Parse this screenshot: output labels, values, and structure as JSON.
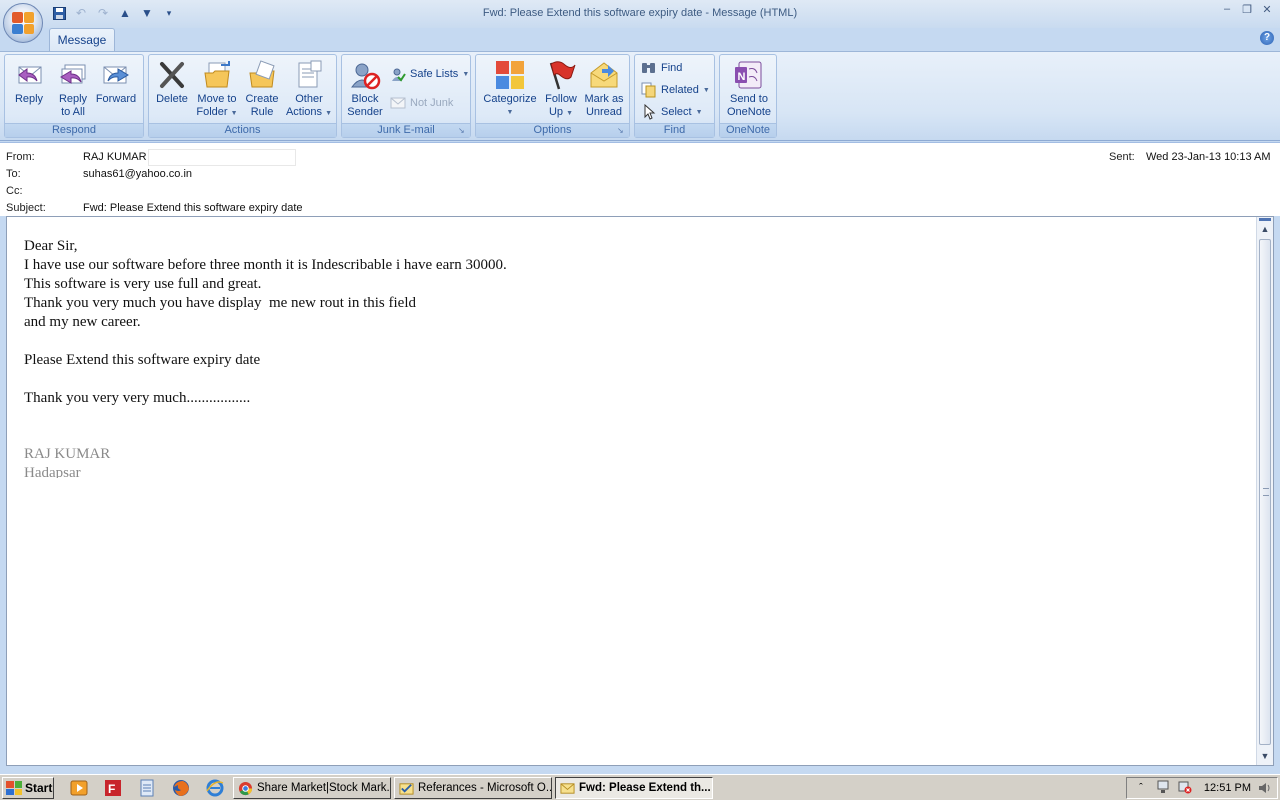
{
  "window": {
    "title": "Fwd: Please Extend this software expiry date - Message (HTML)"
  },
  "ribbon": {
    "tab": "Message",
    "groups": {
      "respond": {
        "label": "Respond",
        "reply": "Reply",
        "reply_all_1": "Reply",
        "reply_all_2": "to All",
        "forward": "Forward"
      },
      "actions": {
        "label": "Actions",
        "delete": "Delete",
        "move_1": "Move to",
        "move_2": "Folder",
        "create_1": "Create",
        "create_2": "Rule",
        "other_1": "Other",
        "other_2": "Actions"
      },
      "junk": {
        "label": "Junk E-mail",
        "block_1": "Block",
        "block_2": "Sender",
        "safe_lists": "Safe Lists",
        "not_junk": "Not Junk"
      },
      "options": {
        "label": "Options",
        "categorize": "Categorize",
        "follow_1": "Follow",
        "follow_2": "Up",
        "mark_1": "Mark as",
        "mark_2": "Unread"
      },
      "find": {
        "label": "Find",
        "find": "Find",
        "related": "Related",
        "select": "Select"
      },
      "onenote": {
        "label": "OneNote",
        "send_1": "Send to",
        "send_2": "OneNote"
      }
    }
  },
  "header": {
    "from_label": "From:",
    "from_value": "RAJ KUMAR |",
    "to_label": "To:",
    "to_value": "suhas61@yahoo.co.in",
    "cc_label": "Cc:",
    "cc_value": "",
    "subject_label": "Subject:",
    "subject_value": "Fwd: Please Extend this software expiry date",
    "sent_label": "Sent:",
    "sent_value": "Wed 23-Jan-13 10:13 AM"
  },
  "message": {
    "lines": [
      "Dear Sir,",
      "I have use our software before three month it is Indescribable i have earn 30000.",
      "This software is very use full and great.",
      "Thank you very much you have display  me new rout in this field",
      "and my new career.",
      "Please Extend this software expiry date",
      "Thank you very very much................."
    ],
    "signature": [
      "RAJ KUMAR",
      "Hadapsar"
    ]
  },
  "taskbar": {
    "start": "Start",
    "buttons": [
      "Share Market|Stock Mark...",
      "Referances - Microsoft O...",
      "Fwd: Please Extend th..."
    ],
    "clock": "12:51 PM"
  },
  "colors": {
    "ribbon_text": "#15428b",
    "ribbon_bg": "#dde9f7",
    "group_label": "#3e6aaa",
    "taskbar": "#d4d0c8"
  },
  "icons": [
    "office-orb-icon",
    "save-icon",
    "undo-icon",
    "redo-icon",
    "up-icon",
    "down-icon",
    "reply-icon",
    "reply-all-icon",
    "forward-icon",
    "delete-icon",
    "move-folder-icon",
    "create-rule-icon",
    "other-actions-icon",
    "block-sender-icon",
    "safe-lists-icon",
    "not-junk-icon",
    "categorize-icon",
    "follow-up-flag-icon",
    "mark-unread-icon",
    "find-icon",
    "related-icon",
    "select-icon",
    "onenote-icon",
    "help-icon"
  ]
}
